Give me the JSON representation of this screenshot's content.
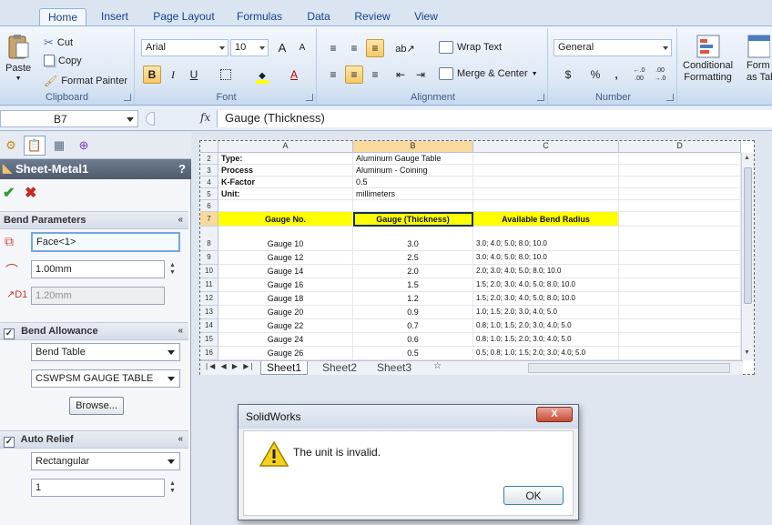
{
  "ribbon": {
    "tabs": [
      {
        "label": "Home",
        "active": true
      },
      {
        "label": "Insert"
      },
      {
        "label": "Page Layout"
      },
      {
        "label": "Formulas"
      },
      {
        "label": "Data"
      },
      {
        "label": "Review"
      },
      {
        "label": "View"
      }
    ],
    "clipboard": {
      "paste": "Paste",
      "cut": "Cut",
      "copy": "Copy",
      "format_painter": "Format Painter",
      "label": "Clipboard"
    },
    "font": {
      "name": "Arial",
      "size": "10",
      "label": "Font",
      "bold": "B",
      "italic": "I",
      "underline": "U",
      "grow": "A",
      "shrink": "A",
      "color_letter": "A"
    },
    "alignment": {
      "wrap_text": "Wrap Text",
      "merge_center": "Merge & Center",
      "label": "Alignment"
    },
    "number": {
      "format": "General",
      "currency": "$",
      "percent": "%",
      "comma": ",",
      "inc_decimal": "←.0 .00",
      "dec_decimal": ".00 →.0",
      "label": "Number"
    },
    "styles": {
      "conditional_formatting": "Conditional",
      "conditional_formatting_2": "Formatting",
      "format_as_table": "Form",
      "format_as_table_2": "as Tab"
    }
  },
  "formula_bar": {
    "name_box": "B7",
    "fx": "fx",
    "formula": "Gauge (Thickness)"
  },
  "property_manager": {
    "title": "Sheet-Metal1",
    "help": "?",
    "bend_parameters": {
      "label": "Bend Parameters",
      "collapse": "«",
      "face": "Face<1>",
      "radius": "1.00mm",
      "thickness": "1.20mm"
    },
    "bend_allowance": {
      "label": "Bend Allowance",
      "collapse": "«",
      "checked": "✓",
      "type": "Bend Table",
      "table": "CSWPSM GAUGE TABLE",
      "browse": "Browse..."
    },
    "auto_relief": {
      "label": "Auto Relief",
      "collapse": "«",
      "checked": "✓",
      "type": "Rectangular",
      "ratio": "1"
    }
  },
  "sheet": {
    "columns": [
      "A",
      "B",
      "C",
      "D"
    ],
    "top_rows": [
      {
        "row": "2",
        "label": "Type:",
        "value": "Aluminum Gauge Table"
      },
      {
        "row": "3",
        "label": "Process",
        "value": "Aluminum - Coining"
      },
      {
        "row": "4",
        "label": "K-Factor",
        "value": "0.5"
      },
      {
        "row": "5",
        "label": "Unit:",
        "value": "millimeters"
      },
      {
        "row": "6",
        "label": "",
        "value": ""
      }
    ],
    "header_row": {
      "row": "7",
      "gauge_no": "Gauge No.",
      "thickness": "Gauge (Thickness)",
      "radius": "Available Bend Radius"
    },
    "data_rows": [
      {
        "row": "8",
        "gauge": "Gauge 10",
        "thickness": "3.0",
        "radius": "3.0; 4.0; 5.0; 8.0; 10.0"
      },
      {
        "row": "9",
        "gauge": "Gauge 12",
        "thickness": "2.5",
        "radius": "3.0; 4.0; 5.0; 8.0; 10.0"
      },
      {
        "row": "10",
        "gauge": "Gauge 14",
        "thickness": "2.0",
        "radius": "2.0; 3.0; 4.0; 5.0; 8.0; 10.0"
      },
      {
        "row": "11",
        "gauge": "Gauge 16",
        "thickness": "1.5",
        "radius": "1.5; 2.0; 3.0; 4.0; 5.0; 8.0; 10.0"
      },
      {
        "row": "12",
        "gauge": "Gauge 18",
        "thickness": "1.2",
        "radius": "1.5; 2.0; 3.0; 4.0; 5.0; 8.0; 10.0"
      },
      {
        "row": "13",
        "gauge": "Gauge 20",
        "thickness": "0.9",
        "radius": "1.0; 1.5; 2.0; 3.0; 4.0; 5.0"
      },
      {
        "row": "14",
        "gauge": "Gauge 22",
        "thickness": "0.7",
        "radius": "0.8; 1.0; 1.5; 2.0; 3.0; 4.0; 5.0"
      },
      {
        "row": "15",
        "gauge": "Gauge 24",
        "thickness": "0.6",
        "radius": "0.8; 1.0; 1.5; 2.0; 3.0; 4.0; 5.0"
      },
      {
        "row": "16",
        "gauge": "Gauge 26",
        "thickness": "0.5",
        "radius": "0.5; 0.8; 1.0; 1.5; 2.0; 3.0; 4.0; 5.0"
      }
    ],
    "tabs": [
      "Sheet1",
      "Sheet2",
      "Sheet3"
    ]
  },
  "dialog": {
    "title": "SolidWorks",
    "close": "X",
    "message": "The unit is invalid.",
    "ok": "OK"
  }
}
